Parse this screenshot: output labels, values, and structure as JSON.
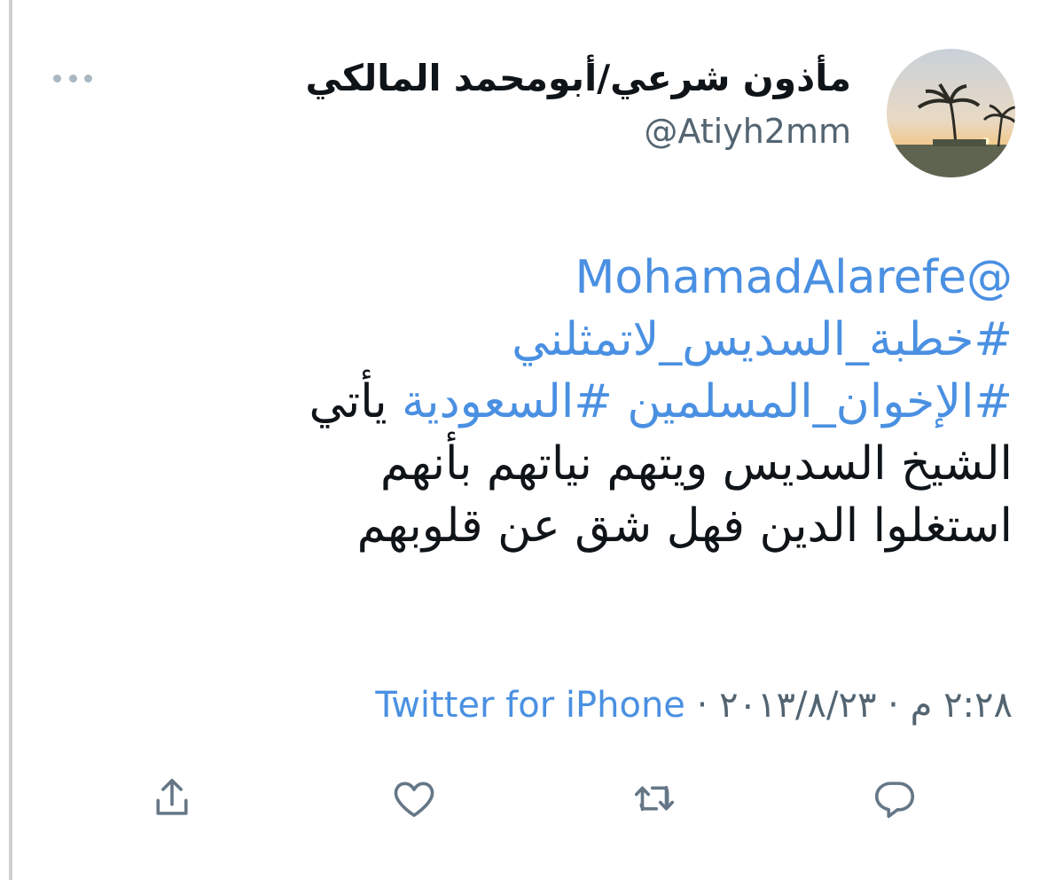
{
  "tweet": {
    "display_name": "مأذون شرعي/أبومحمد المالكي",
    "handle": "@Atiyh2mm",
    "mention": "@MohamadAlarefe",
    "hashtag_1": "#خطبة_السديس_لاتمثلني",
    "hashtag_2": "#الإخوان_المسلمين",
    "hashtag_3": "#السعودية",
    "text_line_1_tail": "يأتي",
    "text_line_2": "الشيخ السديس ويتهم نياتهم بأنهم",
    "text_line_3": "استغلوا الدين فهل شق عن قلوبهم",
    "date": "٢٠١٣/٨/٢٣",
    "separator": "·",
    "time": "٢:٢٨ م",
    "source": "Twitter for iPhone"
  },
  "icons": {
    "more": "more-horizontal-icon",
    "reply": "reply-bubble-icon",
    "retweet": "retweet-icon",
    "like": "heart-icon",
    "share": "share-upload-icon"
  },
  "colors": {
    "link": "#4a90e2",
    "text": "#0f1419",
    "secondary": "#536471",
    "icon": "#657786",
    "rule": "#cfcfd1"
  }
}
